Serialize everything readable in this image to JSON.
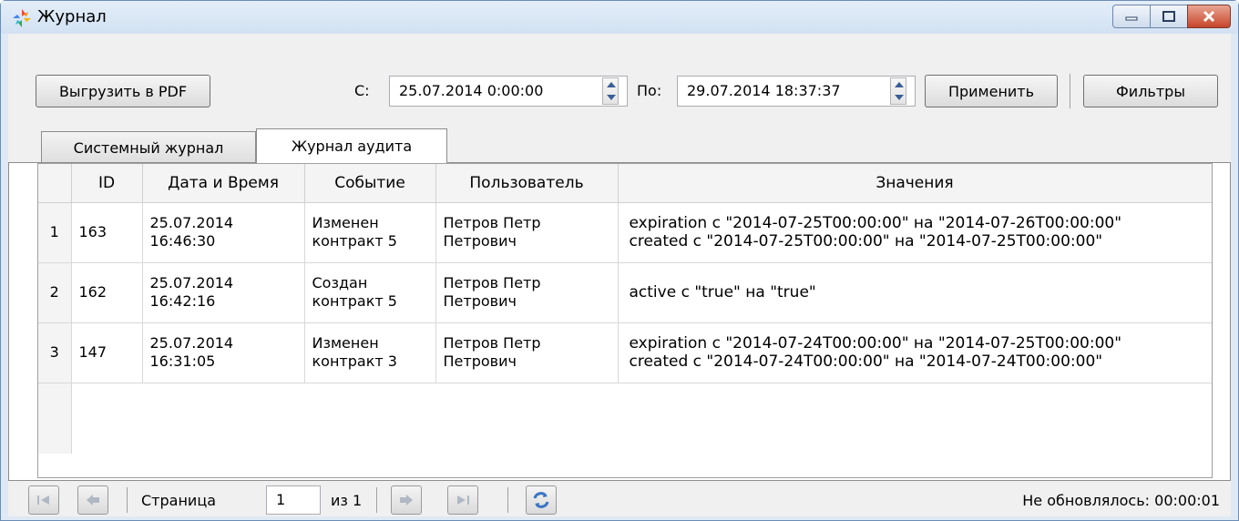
{
  "window": {
    "title": "Журнал"
  },
  "toolbar": {
    "export_label": "Выгрузить в PDF",
    "from_label": "С:",
    "from_value": "25.07.2014 0:00:00",
    "to_label": "По:",
    "to_value": "29.07.2014 18:37:37",
    "apply_label": "Применить",
    "filters_label": "Фильтры"
  },
  "tabs": [
    {
      "label": "Системный журнал",
      "active": false
    },
    {
      "label": "Журнал аудита",
      "active": true
    }
  ],
  "table": {
    "columns": [
      "ID",
      "Дата и Время",
      "Событие",
      "Пользователь",
      "Значения"
    ],
    "rows": [
      {
        "num": "1",
        "id": "163",
        "date": "25.07.2014",
        "time": "16:46:30",
        "event1": "Изменен",
        "event2": "контракт 5",
        "user1": "Петров Петр",
        "user2": "Петрович",
        "val1": "expiration с \"2014-07-25T00:00:00\" на \"2014-07-26T00:00:00\"",
        "val2": "created с \"2014-07-25T00:00:00\" на \"2014-07-25T00:00:00\""
      },
      {
        "num": "2",
        "id": "162",
        "date": "25.07.2014",
        "time": "16:42:16",
        "event1": "Создан",
        "event2": "контракт 5",
        "user1": "Петров Петр",
        "user2": "Петрович",
        "val1": "active с \"true\" на \"true\"",
        "val2": ""
      },
      {
        "num": "3",
        "id": "147",
        "date": "25.07.2014",
        "time": "16:31:05",
        "event1": "Изменен",
        "event2": "контракт 3",
        "user1": "Петров Петр",
        "user2": "Петрович",
        "val1": "expiration с \"2014-07-24T00:00:00\" на \"2014-07-25T00:00:00\"",
        "val2": "created с \"2014-07-24T00:00:00\" на \"2014-07-24T00:00:00\""
      }
    ]
  },
  "pager": {
    "page_label": "Страница",
    "page_value": "1",
    "of_label": "из 1",
    "status": "Не обновлялось: 00:00:01"
  },
  "colors": {
    "accent": "#3a74c4",
    "close": "#c7452b",
    "frame": "#dfe9f5"
  },
  "icons": [
    "app-icon",
    "minimize-icon",
    "maximize-icon",
    "close-icon",
    "first-page-icon",
    "prev-page-icon",
    "next-page-icon",
    "last-page-icon",
    "refresh-icon"
  ]
}
